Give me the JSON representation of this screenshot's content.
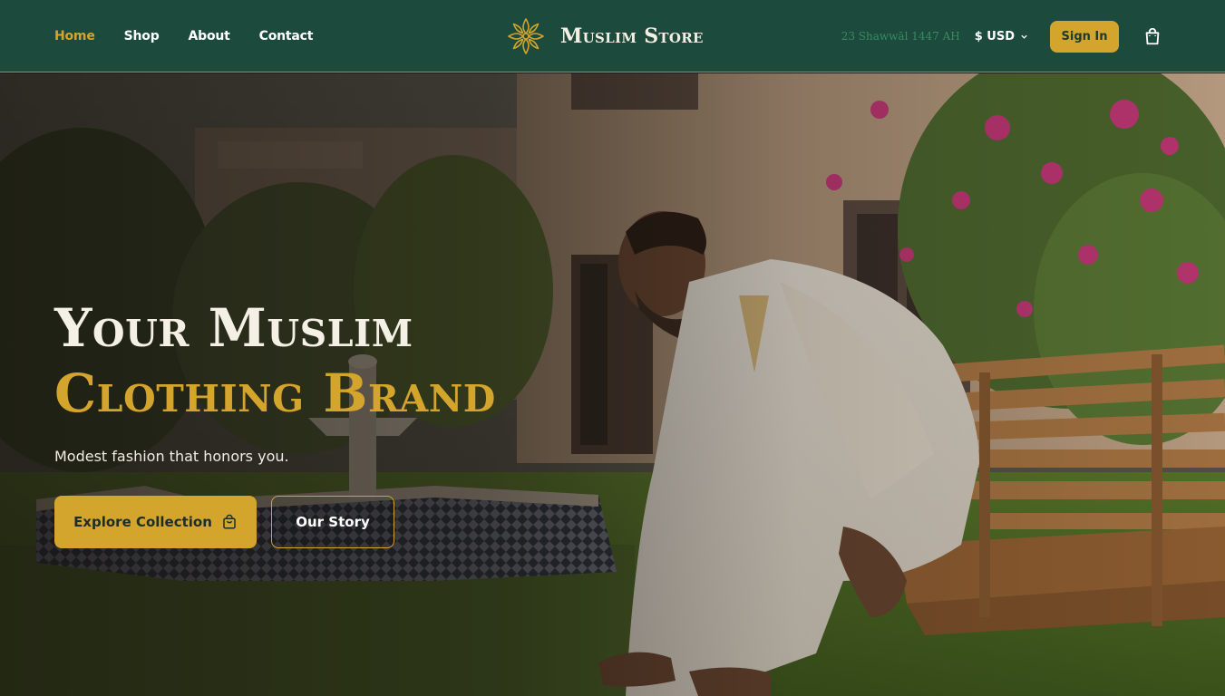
{
  "nav": {
    "links": [
      "Home",
      "Shop",
      "About",
      "Contact"
    ],
    "active": "Home"
  },
  "brand": {
    "name": "Muslim Store",
    "logo_icon": "star-flower-icon"
  },
  "header_right": {
    "hijri_date": "23 Shawwāl 1447 AH",
    "currency": "$ USD",
    "signin_label": "Sign In",
    "cart_icon": "shopping-bag-icon"
  },
  "hero": {
    "title_line1": "Your Muslim",
    "title_line2": "Clothing Brand",
    "subtitle": "Modest fashion that honors you.",
    "explore_label": "Explore Collection",
    "story_label": "Our Story"
  },
  "colors": {
    "header_bg": "#1c4a3c",
    "accent_gold": "#d4a52c",
    "hijri_green": "#3a8a62",
    "title_cream": "#f5f0e6"
  }
}
